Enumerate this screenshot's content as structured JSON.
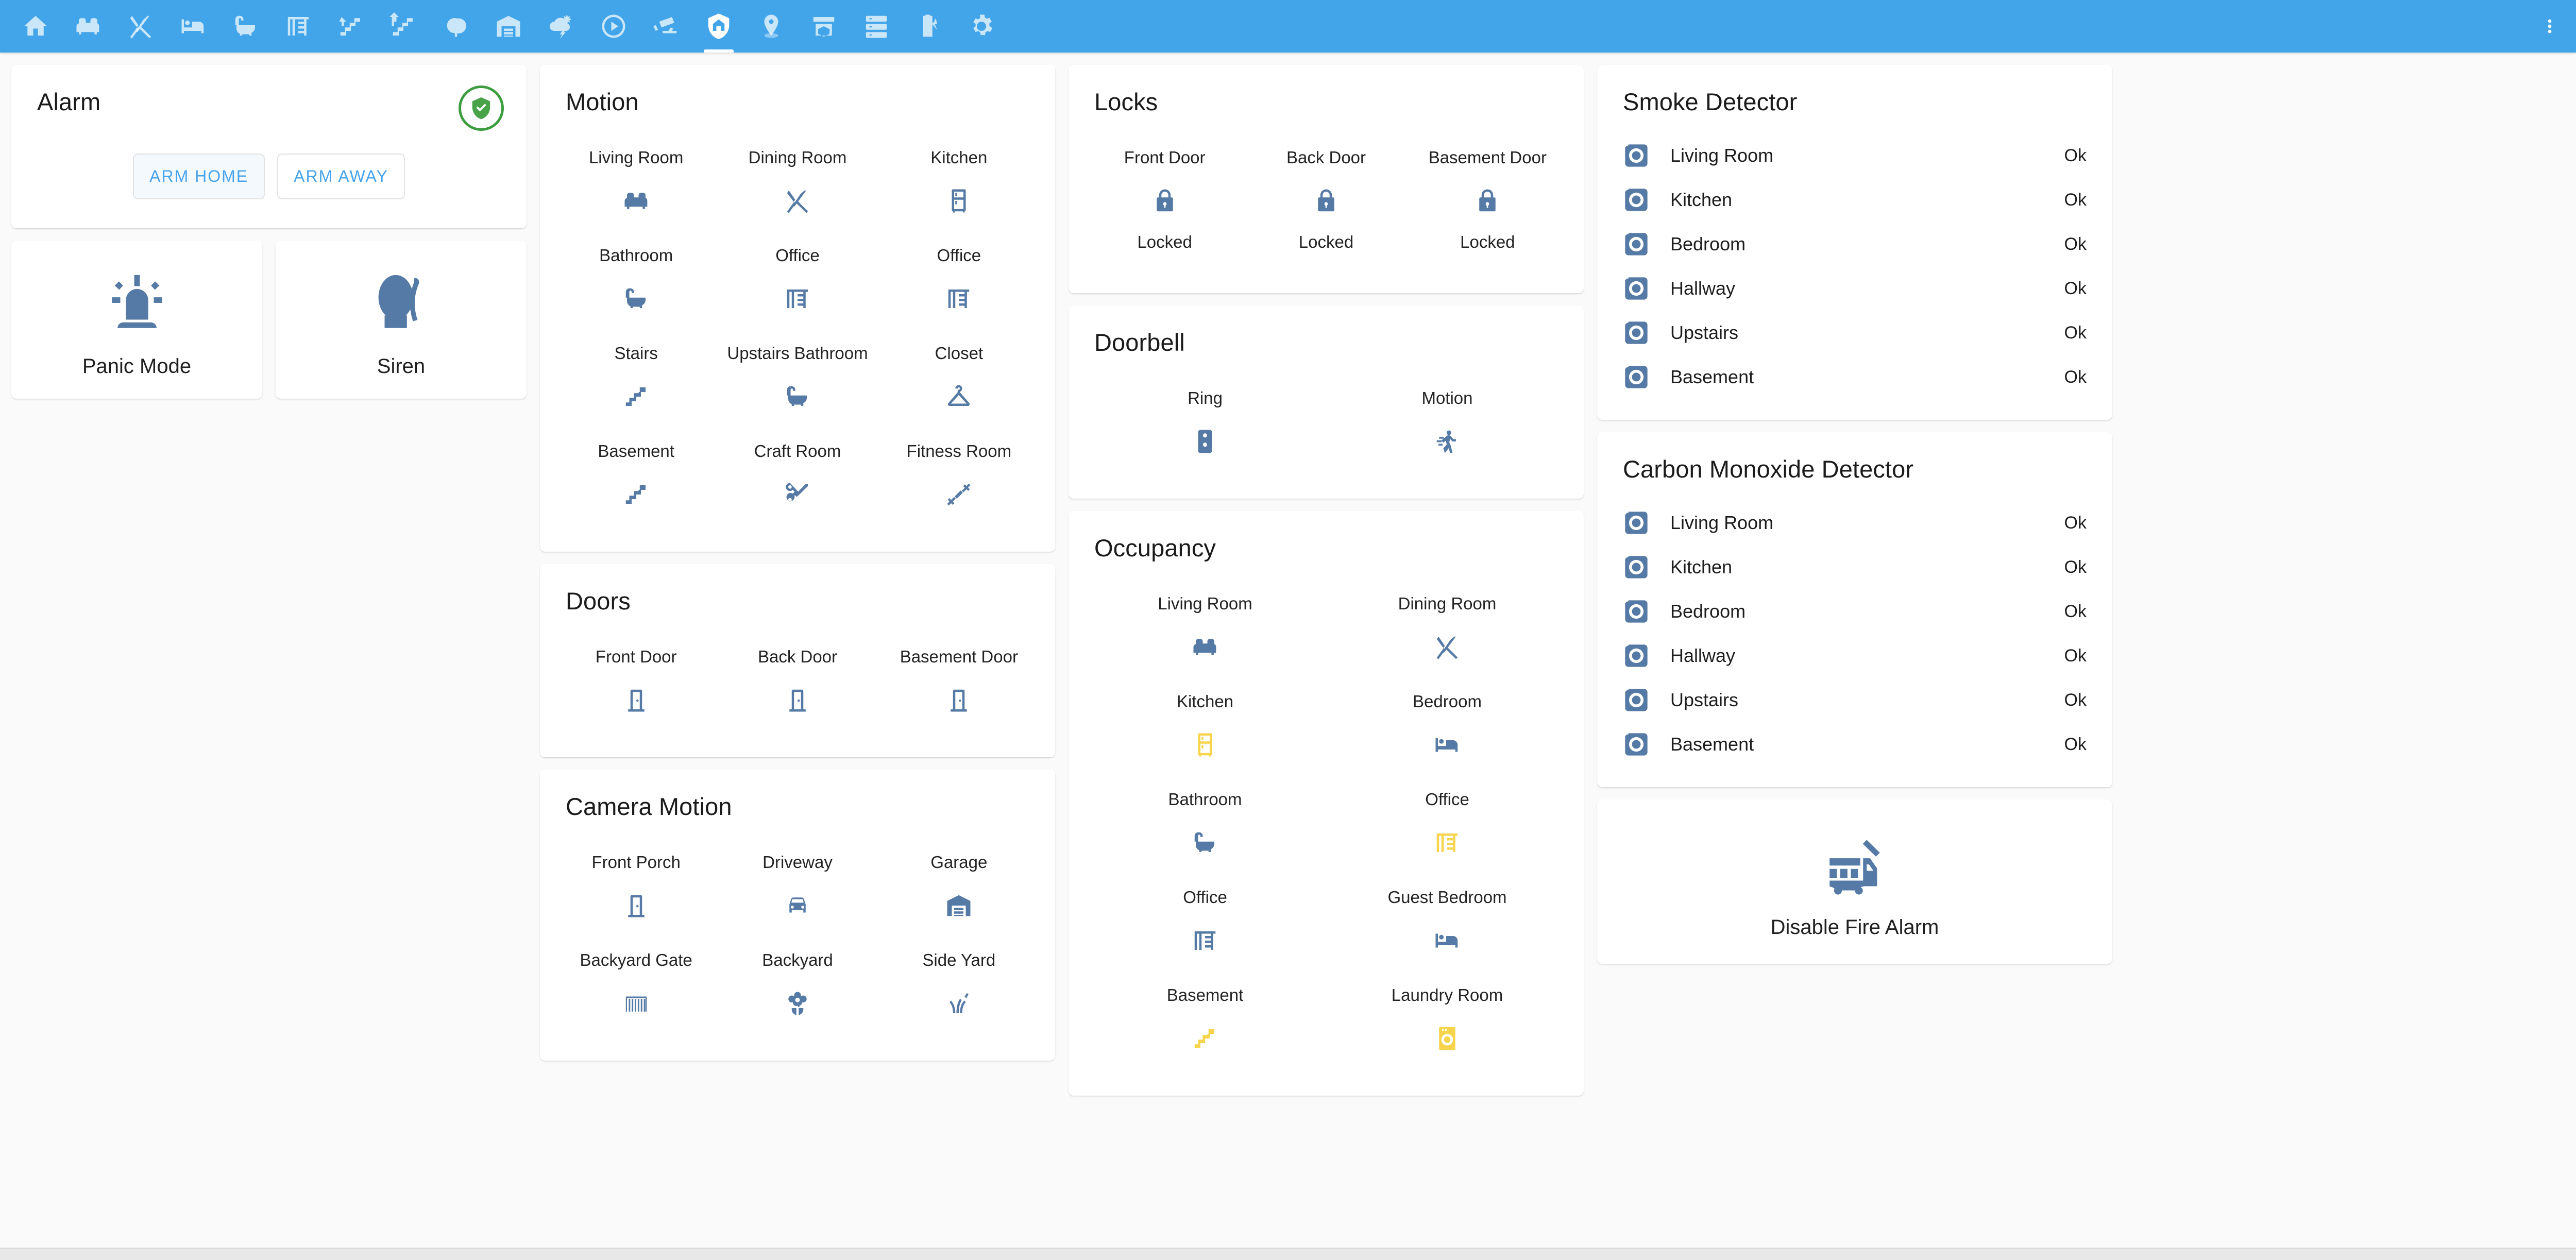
{
  "appbar": {
    "background": "#43a5e9",
    "active_tab_index": 13,
    "tabs": [
      {
        "icon": "home-icon",
        "name": "tab-home"
      },
      {
        "icon": "sofa-icon",
        "name": "tab-living-room"
      },
      {
        "icon": "cutlery-icon",
        "name": "tab-dining-room"
      },
      {
        "icon": "bed-icon",
        "name": "tab-bedroom"
      },
      {
        "icon": "bathtub-icon",
        "name": "tab-bathroom"
      },
      {
        "icon": "desk-icon",
        "name": "tab-office"
      },
      {
        "icon": "stairs-down-icon",
        "name": "tab-downstairs"
      },
      {
        "icon": "stairs-up-icon",
        "name": "tab-upstairs"
      },
      {
        "icon": "tree-icon",
        "name": "tab-outdoors"
      },
      {
        "icon": "garage-icon",
        "name": "tab-garage"
      },
      {
        "icon": "weather-lightning-icon",
        "name": "tab-weather"
      },
      {
        "icon": "play-circle-icon",
        "name": "tab-media"
      },
      {
        "icon": "cctv-icon",
        "name": "tab-cameras"
      },
      {
        "icon": "shield-home-icon",
        "name": "tab-security"
      },
      {
        "icon": "map-marker-icon",
        "name": "tab-locations"
      },
      {
        "icon": "package-delivery-icon",
        "name": "tab-deliveries"
      },
      {
        "icon": "server-icon",
        "name": "tab-system"
      },
      {
        "icon": "battery-charging-icon",
        "name": "tab-energy"
      },
      {
        "icon": "gear-icon",
        "name": "tab-settings"
      }
    ],
    "overflow_icon": "dots-vertical-icon"
  },
  "alarm": {
    "title": "Alarm",
    "status_icon": "shield-check-icon",
    "status_color": "#3d9c40",
    "arm_home_label": "ARM HOME",
    "arm_away_label": "ARM AWAY",
    "arm_home_selected": true
  },
  "quick_tiles": [
    {
      "label": "Panic Mode",
      "icon": "alarm-light-icon"
    },
    {
      "label": "Siren",
      "icon": "bullhorn-icon"
    }
  ],
  "motion": {
    "title": "Motion",
    "items": [
      {
        "name": "Living Room",
        "icon": "sofa-icon",
        "active": false
      },
      {
        "name": "Dining Room",
        "icon": "cutlery-icon",
        "active": false
      },
      {
        "name": "Kitchen",
        "icon": "fridge-icon",
        "active": false
      },
      {
        "name": "Bathroom",
        "icon": "bathtub-icon",
        "active": false
      },
      {
        "name": "Office",
        "icon": "desk-icon",
        "active": false
      },
      {
        "name": "Office",
        "icon": "desk-icon",
        "active": false
      },
      {
        "name": "Stairs",
        "icon": "stairs-icon",
        "active": false
      },
      {
        "name": "Upstairs Bathroom",
        "icon": "bathtub-icon",
        "active": false
      },
      {
        "name": "Closet",
        "icon": "hanger-icon",
        "active": false
      },
      {
        "name": "Basement",
        "icon": "stairs-icon",
        "active": false
      },
      {
        "name": "Craft Room",
        "icon": "scissors-icon",
        "active": false
      },
      {
        "name": "Fitness Room",
        "icon": "dumbbell-icon",
        "active": false
      }
    ]
  },
  "doors": {
    "title": "Doors",
    "items": [
      {
        "name": "Front Door",
        "icon": "door-closed-icon",
        "active": false
      },
      {
        "name": "Back Door",
        "icon": "door-closed-icon",
        "active": false
      },
      {
        "name": "Basement Door",
        "icon": "door-closed-icon",
        "active": false
      }
    ]
  },
  "camera_motion": {
    "title": "Camera Motion",
    "items": [
      {
        "name": "Front Porch",
        "icon": "door-closed-icon",
        "active": false
      },
      {
        "name": "Driveway",
        "icon": "car-icon",
        "active": false
      },
      {
        "name": "Garage",
        "icon": "garage-icon",
        "active": false
      },
      {
        "name": "Backyard Gate",
        "icon": "gate-icon",
        "active": false
      },
      {
        "name": "Backyard",
        "icon": "flower-icon",
        "active": false
      },
      {
        "name": "Side Yard",
        "icon": "grass-icon",
        "active": false
      }
    ]
  },
  "locks": {
    "title": "Locks",
    "items": [
      {
        "name": "Front Door",
        "icon": "lock-icon",
        "state": "Locked"
      },
      {
        "name": "Back Door",
        "icon": "lock-icon",
        "state": "Locked"
      },
      {
        "name": "Basement Door",
        "icon": "lock-icon",
        "state": "Locked"
      }
    ]
  },
  "doorbell": {
    "title": "Doorbell",
    "items": [
      {
        "name": "Ring",
        "icon": "doorbell-icon",
        "active": false
      },
      {
        "name": "Motion",
        "icon": "run-icon",
        "active": false
      }
    ]
  },
  "occupancy": {
    "title": "Occupancy",
    "items": [
      {
        "name": "Living Room",
        "icon": "sofa-icon",
        "active": false
      },
      {
        "name": "Dining Room",
        "icon": "cutlery-icon",
        "active": false
      },
      {
        "name": "Kitchen",
        "icon": "fridge-icon",
        "active": true
      },
      {
        "name": "Bedroom",
        "icon": "bed-icon",
        "active": false
      },
      {
        "name": "Bathroom",
        "icon": "bathtub-icon",
        "active": false
      },
      {
        "name": "Office",
        "icon": "desk-icon",
        "active": true
      },
      {
        "name": "Office",
        "icon": "desk-icon",
        "active": false
      },
      {
        "name": "Guest Bedroom",
        "icon": "bed-icon",
        "active": false
      },
      {
        "name": "Basement",
        "icon": "stairs-icon",
        "active": true
      },
      {
        "name": "Laundry Room",
        "icon": "washing-machine-icon",
        "active": true
      }
    ]
  },
  "smoke_detector": {
    "title": "Smoke Detector",
    "items": [
      {
        "name": "Living Room",
        "icon": "smoke-detector-icon",
        "state": "Ok"
      },
      {
        "name": "Kitchen",
        "icon": "smoke-detector-icon",
        "state": "Ok"
      },
      {
        "name": "Bedroom",
        "icon": "smoke-detector-icon",
        "state": "Ok"
      },
      {
        "name": "Hallway",
        "icon": "smoke-detector-icon",
        "state": "Ok"
      },
      {
        "name": "Upstairs",
        "icon": "smoke-detector-icon",
        "state": "Ok"
      },
      {
        "name": "Basement",
        "icon": "smoke-detector-icon",
        "state": "Ok"
      }
    ]
  },
  "co_detector": {
    "title": "Carbon Monoxide Detector",
    "items": [
      {
        "name": "Living Room",
        "icon": "smoke-detector-icon",
        "state": "Ok"
      },
      {
        "name": "Kitchen",
        "icon": "smoke-detector-icon",
        "state": "Ok"
      },
      {
        "name": "Bedroom",
        "icon": "smoke-detector-icon",
        "state": "Ok"
      },
      {
        "name": "Hallway",
        "icon": "smoke-detector-icon",
        "state": "Ok"
      },
      {
        "name": "Upstairs",
        "icon": "smoke-detector-icon",
        "state": "Ok"
      },
      {
        "name": "Basement",
        "icon": "smoke-detector-icon",
        "state": "Ok"
      }
    ]
  },
  "fire_alarm_tile": {
    "label": "Disable Fire Alarm",
    "icon": "fire-truck-icon"
  },
  "colors": {
    "accent": "#43a5e9",
    "icon_default": "#557aa5",
    "icon_active": "#f7d44c",
    "ok_green": "#3d9c40",
    "card_bg": "#ffffff",
    "page_bg": "#fafafa"
  }
}
